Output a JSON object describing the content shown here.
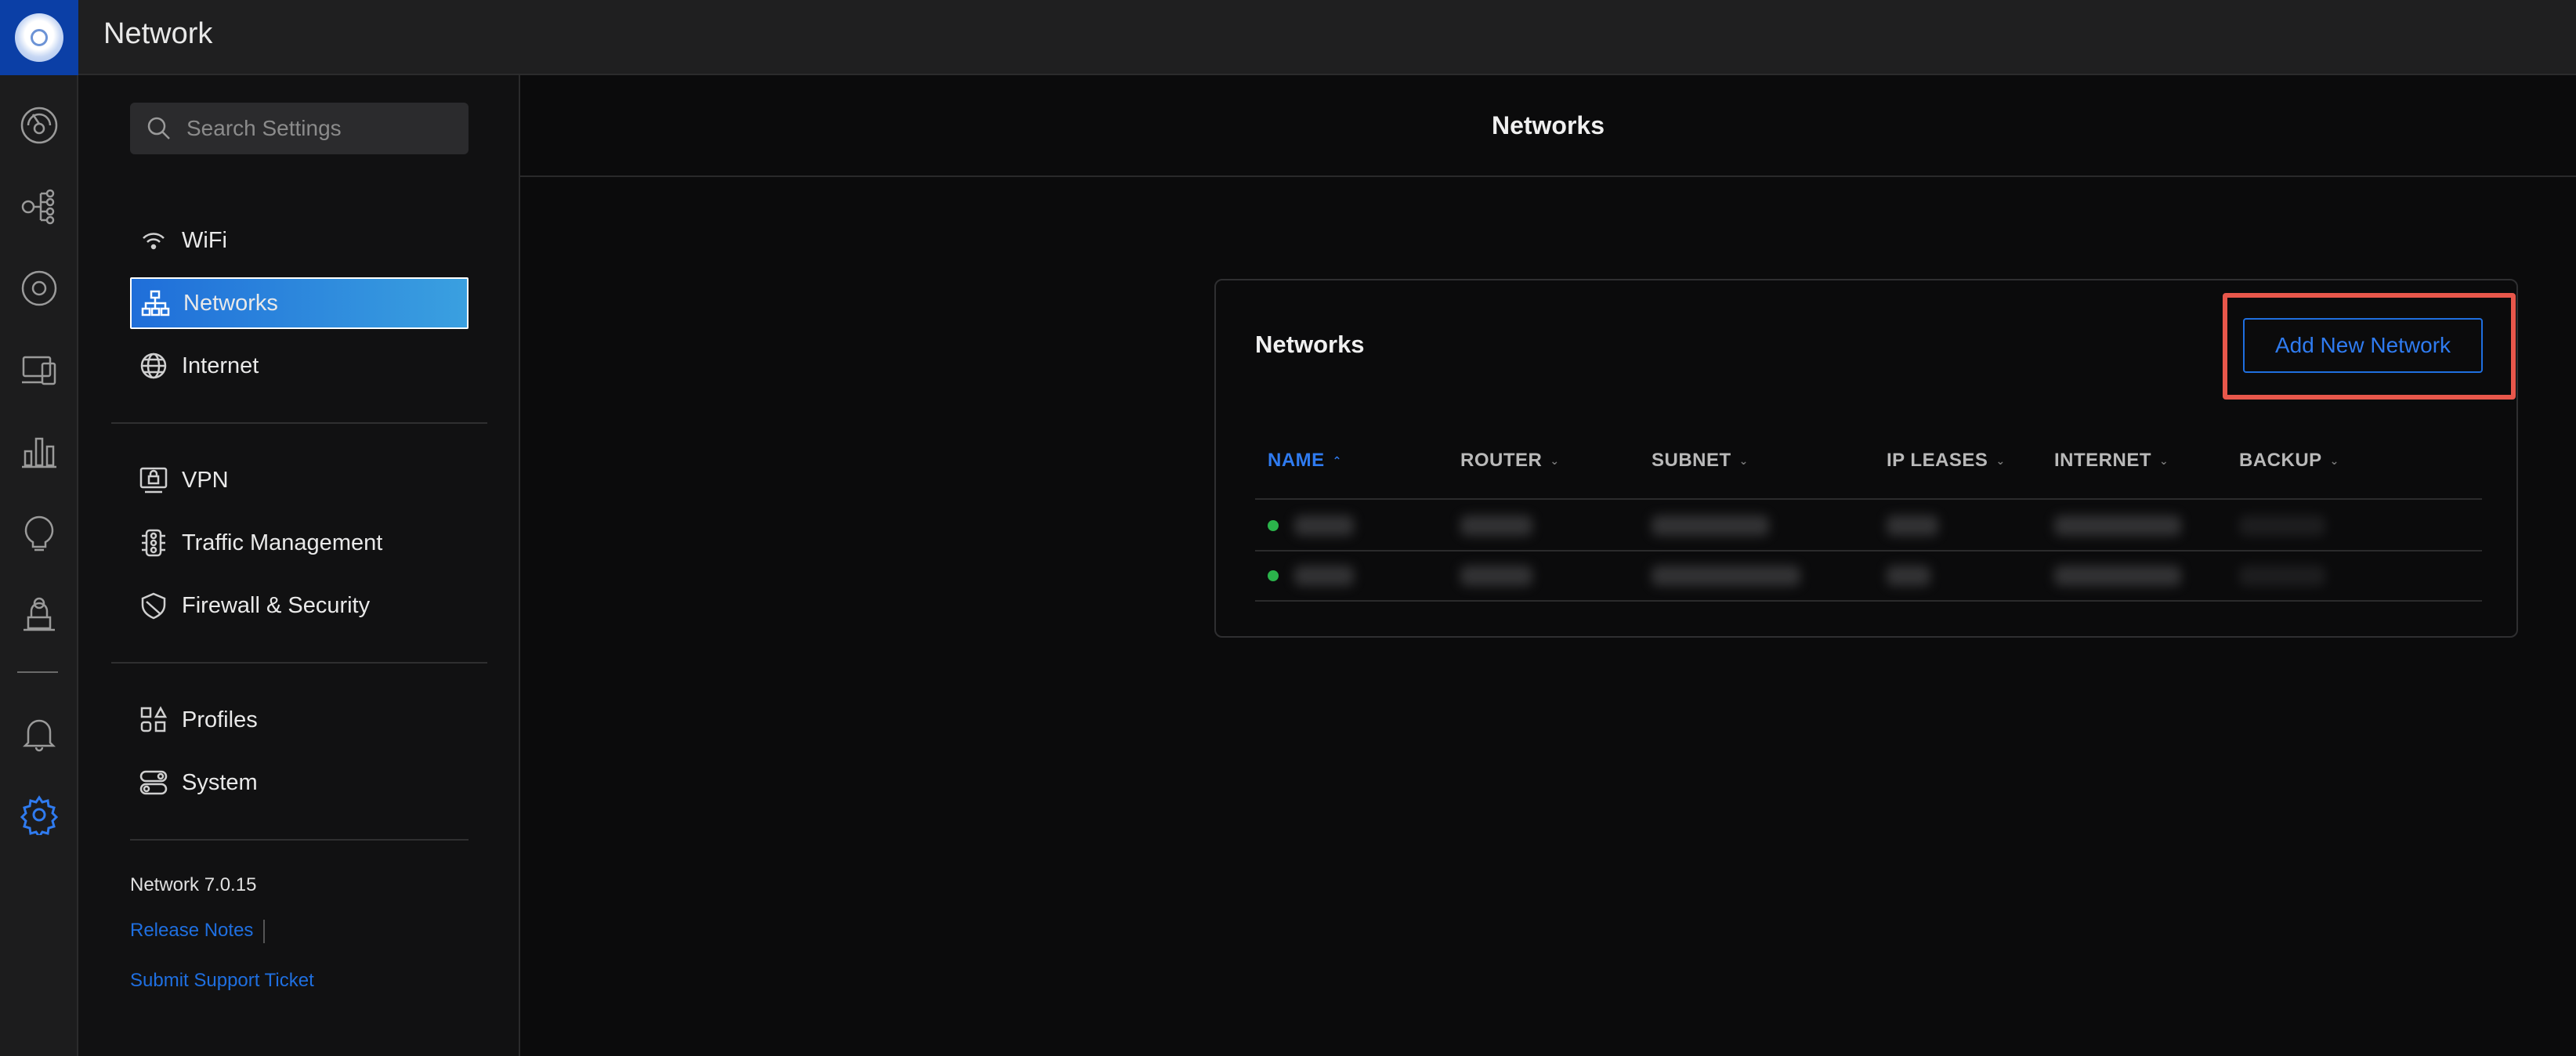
{
  "app": {
    "title": "Network"
  },
  "rail": {
    "items": [
      {
        "name": "dashboard-icon"
      },
      {
        "name": "topology-icon"
      },
      {
        "name": "devices-icon"
      },
      {
        "name": "client-devices-icon"
      },
      {
        "name": "statistics-icon"
      },
      {
        "name": "insights-icon"
      },
      {
        "name": "admin-icon"
      },
      {
        "name": "notifications-icon"
      },
      {
        "name": "settings-icon",
        "active": true
      }
    ]
  },
  "sidebar": {
    "search_placeholder": "Search Settings",
    "groups": [
      {
        "items": [
          {
            "label": "WiFi",
            "icon": "wifi-icon"
          },
          {
            "label": "Networks",
            "icon": "network-tree-icon",
            "active": true
          },
          {
            "label": "Internet",
            "icon": "globe-icon"
          }
        ]
      },
      {
        "items": [
          {
            "label": "VPN",
            "icon": "vpn-icon"
          },
          {
            "label": "Traffic Management",
            "icon": "traffic-icon"
          },
          {
            "label": "Firewall & Security",
            "icon": "shield-icon"
          }
        ]
      },
      {
        "items": [
          {
            "label": "Profiles",
            "icon": "profiles-icon"
          },
          {
            "label": "System",
            "icon": "system-icon"
          }
        ]
      }
    ],
    "version": "Network 7.0.15",
    "release_notes": "Release Notes",
    "support": "Submit Support Ticket"
  },
  "main": {
    "title": "Networks",
    "card": {
      "title": "Networks",
      "add_button": "Add New Network",
      "columns": [
        "NAME",
        "ROUTER",
        "SUBNET",
        "IP LEASES",
        "INTERNET",
        "BACKUP"
      ],
      "sorted_column": "NAME",
      "rows": [
        {
          "status": "online"
        },
        {
          "status": "online"
        }
      ]
    }
  },
  "colors": {
    "accent": "#1f6fe0",
    "highlight": "#e8574b",
    "status_online": "#2bb34b",
    "background": "#0b0b0c"
  }
}
